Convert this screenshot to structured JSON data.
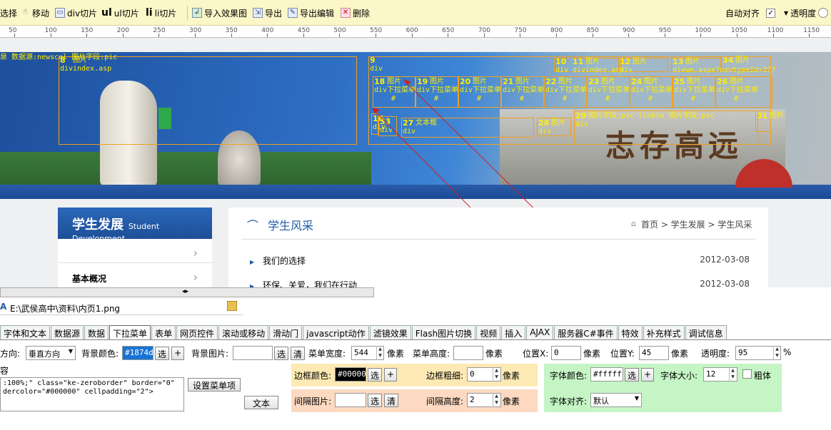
{
  "toolbar": {
    "select": "选择",
    "move": "移动",
    "div_slice": "div切片",
    "ul_slice": "ul切片",
    "li_slice": "li切片",
    "import_effect": "导入效果图",
    "export": "导出",
    "export_edit": "导出编辑",
    "delete": "删除",
    "auto_align": "自动对齐",
    "auto_align_checked": "✓",
    "opacity": "透明度"
  },
  "ruler": [
    "50",
    "100",
    "150",
    "200",
    "250",
    "300",
    "350",
    "400",
    "450",
    "500",
    "550",
    "600",
    "650",
    "700",
    "750",
    "800",
    "850",
    "900",
    "950",
    "1000",
    "1050",
    "1100",
    "1150"
  ],
  "canvas": {
    "top_label": "泉 数据源:newscal  图片字段:pic",
    "slices": [
      {
        "num": "8",
        "tag": "div",
        "label": "图片",
        "extra": "index.asp"
      },
      {
        "num": "9",
        "tag": "div",
        "label": ""
      },
      {
        "num": "10",
        "tag": "div",
        "label": ""
      },
      {
        "num": "11",
        "tag": "div",
        "label": "图片",
        "extra": "index.asp"
      },
      {
        "num": "12",
        "tag": "div",
        "label": "图片"
      },
      {
        "num": "13",
        "tag": "div",
        "label": "图片",
        "extra": "wn.aspx?newtypeId=377"
      },
      {
        "num": "34",
        "tag": "",
        "label": "图片"
      },
      {
        "num": "18",
        "tag": "div",
        "label": "图片",
        "extra": "下拉菜单"
      },
      {
        "num": "19",
        "tag": "div",
        "label": "图片",
        "extra": "下拉菜单"
      },
      {
        "num": "20",
        "tag": "div",
        "label": "图片",
        "extra": "下拉菜单"
      },
      {
        "num": "21",
        "tag": "div",
        "label": "图片",
        "extra": "下拉菜单"
      },
      {
        "num": "22",
        "tag": "div",
        "label": "图片",
        "extra": "下拉菜单"
      },
      {
        "num": "23",
        "tag": "div",
        "label": "图片",
        "extra": "下拉菜单"
      },
      {
        "num": "24",
        "tag": "div",
        "label": "图片",
        "extra": "下拉菜单"
      },
      {
        "num": "25",
        "tag": "div",
        "label": "图片",
        "extra": "下拉菜单"
      },
      {
        "num": "26",
        "tag": "div",
        "label": "图片",
        "extra": "下拉菜单"
      },
      {
        "num": "16",
        "tag": "div",
        "label": ""
      },
      {
        "num": "33",
        "tag": "div",
        "label": ""
      },
      {
        "num": "27",
        "tag": "div",
        "label": "文本框"
      },
      {
        "num": "28",
        "tag": "div",
        "label": "图片"
      },
      {
        "num": "29",
        "tag": "div",
        "label": "图片字段:pic linkto 图片字段:pic"
      },
      {
        "num": "31",
        "tag": "",
        "label": "图片"
      }
    ],
    "hash": "#",
    "sidebar": {
      "title": "学生发展",
      "subtitle": "Student Development",
      "item_blank_arrow": "›",
      "item1": "基本概况",
      "item1_arrow": "›"
    },
    "main": {
      "title": "学生风采",
      "breadcrumb": "首页 > 学生发展 > 学生风采",
      "rows": [
        {
          "title": "我们的选择",
          "date": "2012-03-08"
        },
        {
          "title": "环保、关爱，我们在行动",
          "date": "2012-03-08"
        }
      ]
    },
    "calligraphy": "志存高远"
  },
  "splitter_arrows": "◂▸",
  "path": "E:\\武侯高中\\资料\\内页1.png",
  "tabs": [
    "字体和文本",
    "数据源",
    "数据",
    "下拉菜单",
    "表单",
    "网页控件",
    "滚动或移动",
    "滑动门",
    "javascript动作",
    "滤镜效果",
    "Flash图片切换",
    "视频",
    "插入",
    "AJAX",
    "服务器C#事件",
    "特效",
    "补充样式",
    "调试信息"
  ],
  "active_tab": 3,
  "props": {
    "direction_label": "方向:",
    "direction_value": "垂直方向",
    "bg_color_label": "背景颜色:",
    "bg_color_value": "#1874d",
    "select": "选",
    "plus": "+",
    "bg_image_label": "背景图片:",
    "bg_image_value": "",
    "clear": "清",
    "menu_width_label": "菜单宽度:",
    "menu_width_value": "544",
    "px": "像素",
    "menu_height_label": "菜单高度:",
    "menu_height_value": "",
    "pos_x_label": "位置X:",
    "pos_x_value": "0",
    "pos_y_label": "位置Y:",
    "pos_y_value": "45",
    "opacity_label": "透明度:",
    "opacity_value": "95",
    "percent": "%",
    "content_label": "容",
    "code_line1": ":100%;\" class=\"ke-zeroborder\" border=\"0\"",
    "code_line2": "dercolor=\"#000000\" cellpadding=\"2\">",
    "set_menu_items": "设置菜单项",
    "text_btn": "文本",
    "border_color_label": "边框颜色:",
    "border_color_value": "#000000",
    "border_width_label": "边框粗细:",
    "border_width_value": "0",
    "font_color_label": "字体颜色:",
    "font_color_value": "#ffffff",
    "font_size_label": "字体大小:",
    "font_size_value": "12",
    "bold_label": "粗体",
    "spacing_image_label": "间隔图片:",
    "spacing_image_value": "",
    "spacing_height_label": "间隔高度:",
    "spacing_height_value": "2",
    "font_align_label": "字体对齐:",
    "font_align_value": "默认"
  },
  "colors": {
    "toolbar_bg": "#fbf7c8",
    "bg_color_swatch": "#1874d4",
    "border_panel": "#fde9b3",
    "spacing_panel": "#fcd9c0",
    "font_panel": "#c5f5c5"
  }
}
